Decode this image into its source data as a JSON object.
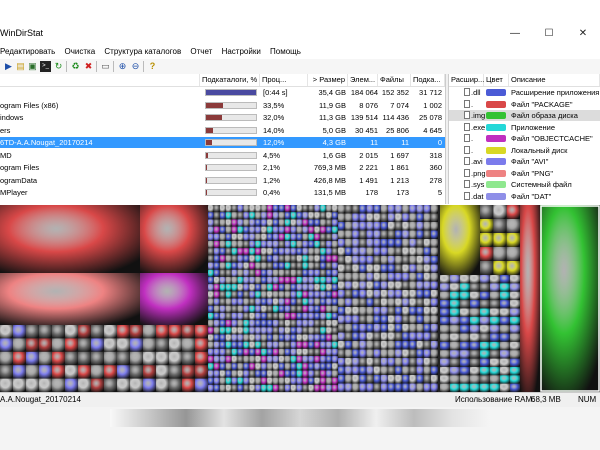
{
  "window": {
    "title": "WinDirStat",
    "minimize_glyph": "—",
    "maximize_glyph": "☐",
    "close_glyph": "✕"
  },
  "menu": [
    "Редактировать",
    "Очистка",
    "Структура каталогов",
    "Отчет",
    "Настройки",
    "Помощь"
  ],
  "toolbar_icons": [
    "play-icon",
    "folder-icon",
    "save-icon",
    "terminal-icon",
    "refresh-icon",
    "recycle-icon",
    "delete-icon",
    "new-folder-icon",
    "zoom-in-icon",
    "zoom-out-icon",
    "help-icon"
  ],
  "tree": {
    "headers": [
      "",
      "Подкаталоги, %",
      "Проц...",
      "> Размер",
      "Элем...",
      "Файлы",
      "Подка..."
    ],
    "rows": [
      {
        "name": "",
        "percent": 100,
        "pct": "[0:44 s]",
        "size": "35,4 GB",
        "items": "184 064",
        "files": "152 352",
        "subdirs": "31 712",
        "bar_color": "#4a4aa0"
      },
      {
        "name": "ogram Files (x86)",
        "percent": 33.5,
        "pct": "33,5%",
        "size": "11,9 GB",
        "items": "8 076",
        "files": "7 074",
        "subdirs": "1 002",
        "bar_color": "#8b3a3a"
      },
      {
        "name": "indows",
        "percent": 32.0,
        "pct": "32,0%",
        "size": "11,3 GB",
        "items": "139 514",
        "files": "114 436",
        "subdirs": "25 078",
        "bar_color": "#8b3a3a"
      },
      {
        "name": "ers",
        "percent": 14.0,
        "pct": "14,0%",
        "size": "5,0 GB",
        "items": "30 451",
        "files": "25 806",
        "subdirs": "4 645",
        "bar_color": "#8b3a3a"
      },
      {
        "name": "6TD-A.A.Nougat_20170214",
        "percent": 12.0,
        "pct": "12,0%",
        "size": "4,3 GB",
        "items": "11",
        "files": "11",
        "subdirs": "0",
        "bar_color": "#8b3a3a",
        "selected": true
      },
      {
        "name": "MD",
        "percent": 4.5,
        "pct": "4,5%",
        "size": "1,6 GB",
        "items": "2 015",
        "files": "1 697",
        "subdirs": "318",
        "bar_color": "#8b3a3a"
      },
      {
        "name": "ogram Files",
        "percent": 2.1,
        "pct": "2,1%",
        "size": "769,3 MB",
        "items": "2 221",
        "files": "1 861",
        "subdirs": "360",
        "bar_color": "#8b3a3a"
      },
      {
        "name": "ogramData",
        "percent": 1.2,
        "pct": "1,2%",
        "size": "426,8 MB",
        "items": "1 491",
        "files": "1 213",
        "subdirs": "278",
        "bar_color": "#8b3a3a"
      },
      {
        "name": "MPlayer",
        "percent": 0.4,
        "pct": "0,4%",
        "size": "131,5 MB",
        "items": "178",
        "files": "173",
        "subdirs": "5",
        "bar_color": "#8b3a3a"
      }
    ]
  },
  "ext": {
    "headers": [
      "Расшир...",
      "Цвет",
      "Описание"
    ],
    "rows": [
      {
        "ext": ".dll",
        "color": "#4b5bd6",
        "desc": "Расширение приложения"
      },
      {
        "ext": ".",
        "color": "#d94848",
        "desc": "Файл \"PACKAGE\""
      },
      {
        "ext": ".img",
        "color": "#33c233",
        "desc": "Файл образа диска",
        "selected": true
      },
      {
        "ext": ".exe",
        "color": "#24d8d8",
        "desc": "Приложение"
      },
      {
        "ext": ".",
        "color": "#c02fc0",
        "desc": "Файл \"OBJECTCACHE\""
      },
      {
        "ext": ".",
        "color": "#d8d824",
        "desc": "Локальный диск"
      },
      {
        "ext": ".avi",
        "color": "#7b7bec",
        "desc": "Файл \"AVI\""
      },
      {
        "ext": ".png",
        "color": "#ee8282",
        "desc": "Файл \"PNG\""
      },
      {
        "ext": ".sys",
        "color": "#8fe88f",
        "desc": "Системный файл"
      },
      {
        "ext": ".dat",
        "color": "#8f8fe8",
        "desc": "Файл \"DAT\""
      }
    ]
  },
  "status": {
    "path": "A.A.Nougat_20170214",
    "ram_label": "Использование RAM:",
    "ram_value": "68,3 MB",
    "mode": "NUM"
  }
}
